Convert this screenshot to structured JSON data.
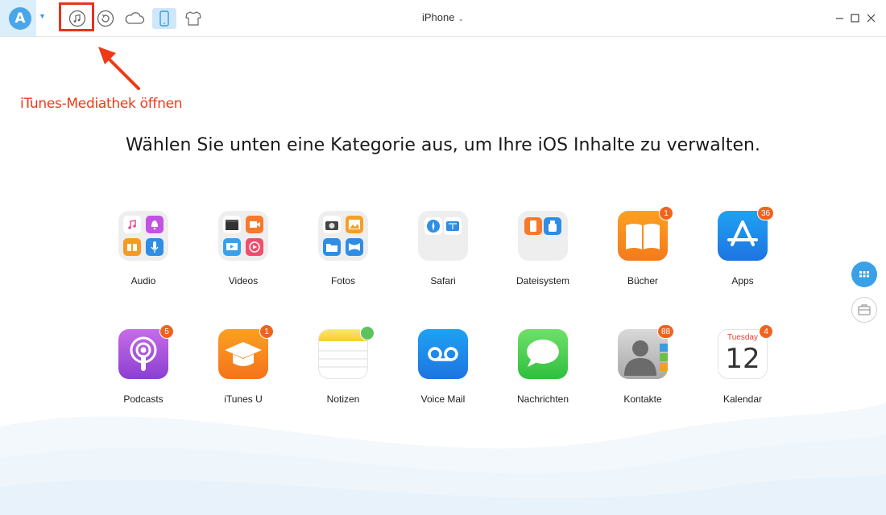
{
  "window": {
    "device_name": "iPhone"
  },
  "toolbar": {
    "items": [
      "app-logo",
      "itunes-library",
      "backup-restore",
      "icloud",
      "device",
      "customize"
    ]
  },
  "annotation": {
    "text": "iTunes-Mediathek öffnen",
    "color": "#e8321e"
  },
  "headline": "Wählen Sie unten eine Kategorie aus, um Ihre iOS Inhalte zu verwalten.",
  "categories": [
    {
      "label": "Audio",
      "badge": ""
    },
    {
      "label": "Videos",
      "badge": ""
    },
    {
      "label": "Fotos",
      "badge": ""
    },
    {
      "label": "Safari",
      "badge": ""
    },
    {
      "label": "Dateisystem",
      "badge": ""
    },
    {
      "label": "Bücher",
      "badge": "1"
    },
    {
      "label": "Apps",
      "badge": "36"
    },
    {
      "label": "Podcasts",
      "badge": "5"
    },
    {
      "label": "iTunes U",
      "badge": "1"
    },
    {
      "label": "Notizen",
      "badge": ""
    },
    {
      "label": "Voice Mail",
      "badge": ""
    },
    {
      "label": "Nachrichten",
      "badge": ""
    },
    {
      "label": "Kontakte",
      "badge": "88"
    },
    {
      "label": "Kalendar",
      "badge": "4"
    }
  ],
  "calendar": {
    "day_name": "Tuesday",
    "day_number": "12"
  },
  "colors": {
    "accent": "#4aa6e8",
    "badge": "#f0631f"
  }
}
